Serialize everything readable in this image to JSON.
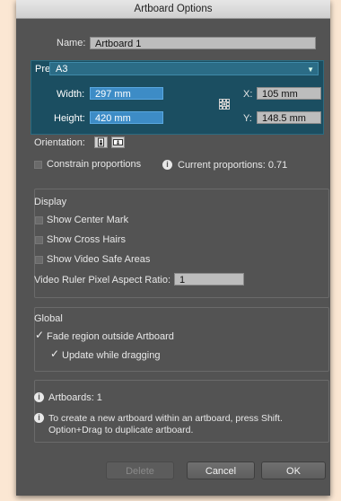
{
  "window": {
    "title": "Artboard Options"
  },
  "name": {
    "label": "Name:",
    "value": "Artboard 1"
  },
  "preset": {
    "label": "Preset:",
    "value": "A3"
  },
  "width": {
    "label": "Width:",
    "value": "297 mm"
  },
  "height": {
    "label": "Height:",
    "value": "420 mm"
  },
  "x": {
    "label": "X:",
    "value": "105 mm"
  },
  "y": {
    "label": "Y:",
    "value": "148.5 mm"
  },
  "orientation": {
    "label": "Orientation:"
  },
  "constrain": {
    "label": "Constrain proportions",
    "checked": false
  },
  "current_proportions": {
    "label": "Current proportions: 0.71"
  },
  "display": {
    "title": "Display",
    "show_center_mark": "Show Center Mark",
    "show_cross_hairs": "Show Cross Hairs",
    "show_video_safe": "Show Video Safe Areas",
    "ratio_label": "Video Ruler Pixel Aspect Ratio:",
    "ratio_value": "1"
  },
  "global": {
    "title": "Global",
    "fade_label": "Fade region outside Artboard",
    "update_label": "Update while dragging"
  },
  "info": {
    "artboards": "Artboards: 1",
    "hint_line1": "To create a new artboard within an artboard, press Shift.",
    "hint_line2": "Option+Drag to duplicate artboard."
  },
  "buttons": {
    "delete": "Delete",
    "cancel": "Cancel",
    "ok": "OK"
  }
}
